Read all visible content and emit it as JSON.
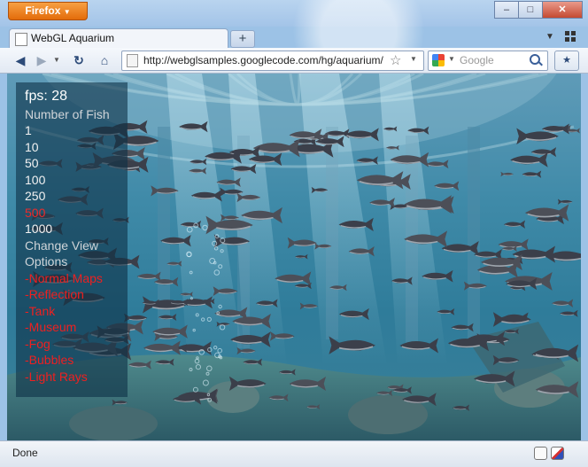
{
  "browser": {
    "app_menu_label": "Firefox",
    "app_menu_arrow": "▼",
    "window_controls": {
      "minimize": "–",
      "maximize": "□",
      "close": "✕"
    },
    "tab": {
      "title": "WebGL Aquarium"
    },
    "new_tab_label": "+",
    "tab_list_arrow": "▼",
    "nav": {
      "back": "◀",
      "forward": "▶",
      "history_arrow": "▼",
      "reload": "↻",
      "home": "⌂",
      "url": "http://webglsamples.googlecode.com/hg/aquarium/",
      "bookmark_star": "☆",
      "url_dropdown": "▼",
      "search_engine_arrow": "▼",
      "search_placeholder": "Google",
      "bookmarks_button": "★"
    },
    "status": "Done"
  },
  "aquarium": {
    "fps_label": "fps: 28",
    "fish_heading": "Number of Fish",
    "fish_counts": [
      "1",
      "10",
      "50",
      "100",
      "250",
      "500",
      "1000"
    ],
    "active_fish_count": "500",
    "change_view": "Change View",
    "options_heading": "Options",
    "options": [
      "-Normal Maps",
      "-Reflection",
      "-Tank",
      "-Museum",
      "-Fog",
      "-Bubbles",
      "-Light Rays"
    ]
  },
  "colors": {
    "active_count": "#ee2a2a",
    "option_link": "#ee2020",
    "water": "#2f7c9a",
    "app_button": "#e36c0a"
  }
}
